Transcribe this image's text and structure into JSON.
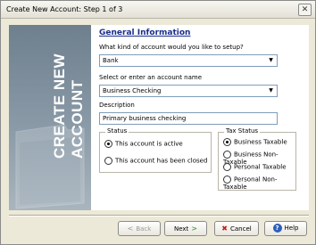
{
  "window": {
    "title": "Create New Account: Step 1 of 3",
    "close_glyph": "✕"
  },
  "side_panel": {
    "line1": "CREATE NEW",
    "line2": "ACCOUNT"
  },
  "form": {
    "section_title": "General Information",
    "account_type": {
      "label": "What kind of account would you like to setup?",
      "value": "Bank"
    },
    "account_name": {
      "label": "Select or enter an account name",
      "value": "Business Checking"
    },
    "description": {
      "label": "Description",
      "value": "Primary business checking"
    },
    "status": {
      "label": "Status",
      "options": [
        {
          "label": "This account is active",
          "selected": true
        },
        {
          "label": "This account has been closed",
          "selected": false
        }
      ]
    },
    "tax_status": {
      "label": "Tax Status",
      "options": [
        {
          "label": "Business Taxable",
          "selected": true
        },
        {
          "label": "Business Non-Taxable",
          "selected": false
        },
        {
          "label": "Personal Taxable",
          "selected": false
        },
        {
          "label": "Personal Non-Taxable",
          "selected": false
        }
      ]
    }
  },
  "buttons": {
    "back": "Back",
    "next": "Next",
    "cancel": "Cancel",
    "help": "Help"
  },
  "colors": {
    "section_title": "#1a2e8a",
    "cancel_icon": "#c0201c",
    "help_icon": "#2b5fb8",
    "next_icon": "#2f8a2f"
  }
}
